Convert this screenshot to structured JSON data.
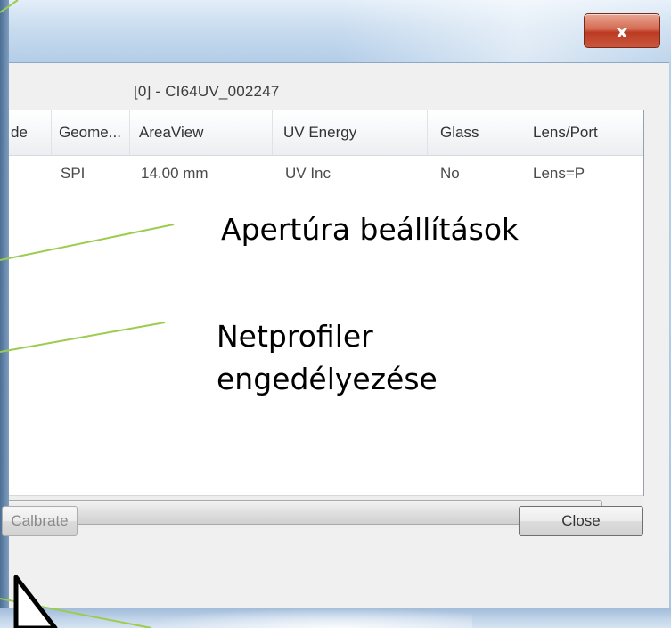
{
  "window": {
    "close_glyph": "x",
    "device_label": "[0] - CI64UV_002247"
  },
  "list": {
    "columns": [
      "de",
      "Geome...",
      "AreaView",
      "UV Energy",
      "Glass",
      "Lens/Port"
    ],
    "rows": [
      [
        "",
        "SPI",
        "14.00 mm",
        "UV Inc",
        "No",
        "Lens=P"
      ]
    ]
  },
  "buttons": {
    "calibrate": "Calbrate",
    "close": "Close"
  },
  "annotations": {
    "aperture": "Apertúra beállítások",
    "netprofiler": "Netprofiler engedélyezése",
    "line_color": "#9ccc4e"
  },
  "icons": {
    "scroll_right": "scroll-right-arrow-icon",
    "cursor": "mouse-pointer-icon"
  }
}
